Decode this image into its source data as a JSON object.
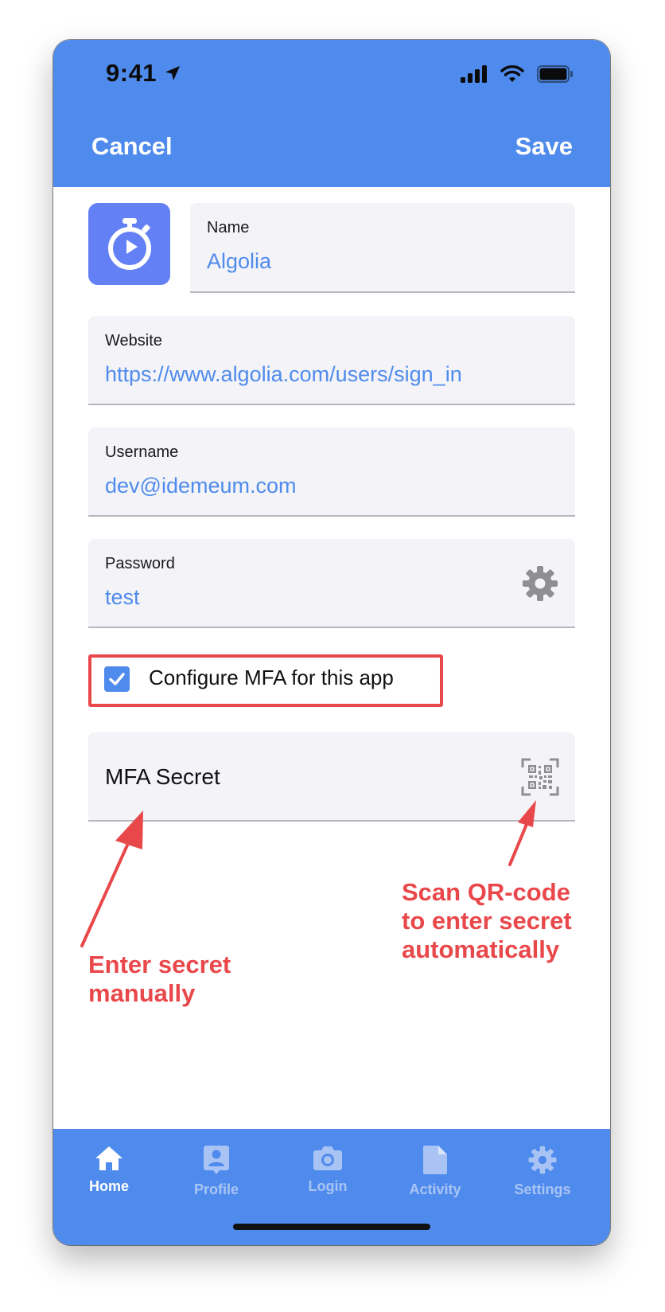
{
  "status_bar": {
    "time": "9:41"
  },
  "header": {
    "cancel_label": "Cancel",
    "save_label": "Save"
  },
  "form": {
    "name": {
      "label": "Name",
      "value": "Algolia"
    },
    "website": {
      "label": "Website",
      "value": "https://www.algolia.com/users/sign_in"
    },
    "username": {
      "label": "Username",
      "value": "dev@idemeum.com"
    },
    "password": {
      "label": "Password",
      "value": "test"
    },
    "mfa_checkbox": {
      "label": "Configure MFA for this app",
      "checked": true
    },
    "mfa_secret": {
      "placeholder": "MFA Secret"
    }
  },
  "annotations": {
    "left_line1": "Enter secret",
    "left_line2": "manually",
    "right_line1": "Scan QR-code",
    "right_line2": "to enter secret",
    "right_line3": "automatically"
  },
  "tabs": [
    {
      "label": "Home",
      "icon": "home-icon",
      "active": true
    },
    {
      "label": "Profile",
      "icon": "profile-icon",
      "active": false
    },
    {
      "label": "Login",
      "icon": "camera-icon",
      "active": false
    },
    {
      "label": "Activity",
      "icon": "document-icon",
      "active": false
    },
    {
      "label": "Settings",
      "icon": "gear-icon",
      "active": false
    }
  ],
  "colors": {
    "primary": "#4f8bec",
    "app_icon_bg": "#6380f5",
    "field_bg": "#f3f3f8",
    "annotation": "#e9484b"
  }
}
